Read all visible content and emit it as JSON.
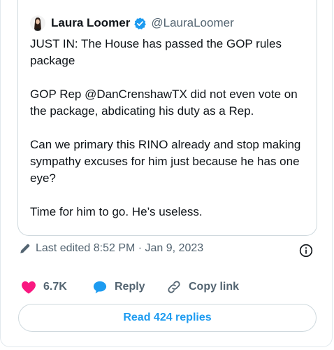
{
  "quoted_tweet": {
    "author_name": "Laura Loomer",
    "author_handle": "@LauraLoomer",
    "paragraphs": [
      "JUST IN: The House has passed the GOP rules package",
      "GOP Rep @DanCrenshawTX did not even vote on the package, abdicating his duty as a Rep.",
      "Can we primary this RINO already and stop making sympathy excuses for him just because he has one eye?",
      "Time for him to go. He’s useless."
    ]
  },
  "meta": {
    "edited_text": "Last edited 8:52 PM · Jan 9, 2023"
  },
  "actions": {
    "likes_count": "6.7K",
    "reply_label": "Reply",
    "copy_link_label": "Copy link"
  },
  "read_replies_label": "Read 424 replies",
  "colors": {
    "like": "#f91880",
    "reply": "#1d9bf0",
    "verified": "#1d9bf0",
    "link": "#1d9bf0",
    "muted": "#536471"
  },
  "icons": [
    "verified-badge-icon",
    "pencil-icon",
    "info-icon",
    "heart-icon",
    "speech-bubble-icon",
    "link-icon"
  ]
}
